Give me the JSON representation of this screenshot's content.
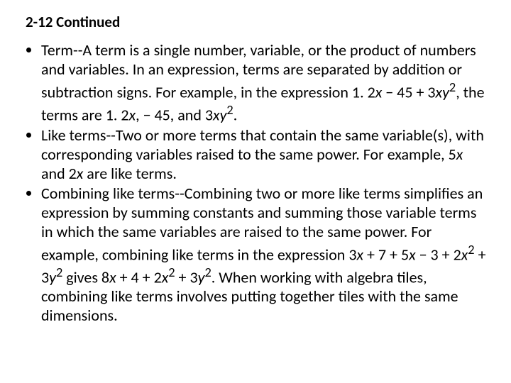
{
  "title": "2-12 Continued",
  "bullets": [
    {
      "pre": "Term--A term is a single number,  variable, or the product of numbers and variables.  In an expression, terms are separated by addition or subtraction signs.  For example, in the expression 1. 2",
      "m1": "x",
      "mid1": " − 45 + 3",
      "m2": "xy",
      "sup1": "2",
      "mid2": ", the terms are 1. 2",
      "m3": "x",
      "mid3": ", − 45, and 3",
      "m4": "xy",
      "sup2": "2",
      "end": "."
    },
    {
      "pre": "Like terms--Two or more terms that contain the same variable(s), with corresponding variables raised to the same power.  For example, 5",
      "m1": "x",
      "mid1": " and 2",
      "m2": "x",
      "end": " are like terms."
    },
    {
      "pre": "Combining like terms--Combining two or more like terms simplifies an expression by summing constants and summing those variable terms in which the same variables are raised to the same power.  For example, combining like terms in the expression 3",
      "m1": "x",
      "mid1": " + 7 + 5",
      "m2": "x",
      "mid2": " − 3 + 2",
      "m3": "x",
      "sup1": "2",
      "mid3": " + 3",
      "m4": "y",
      "sup2": "2",
      "mid4": " gives 8",
      "m5": "x",
      "mid5": " + 4 + 2",
      "m6": "x",
      "sup3": "2",
      "mid6": " + 3",
      "m7": "y",
      "sup4": "2",
      "end": ".  When working with algebra tiles, combining like terms involves putting together tiles with the same dimensions."
    }
  ]
}
